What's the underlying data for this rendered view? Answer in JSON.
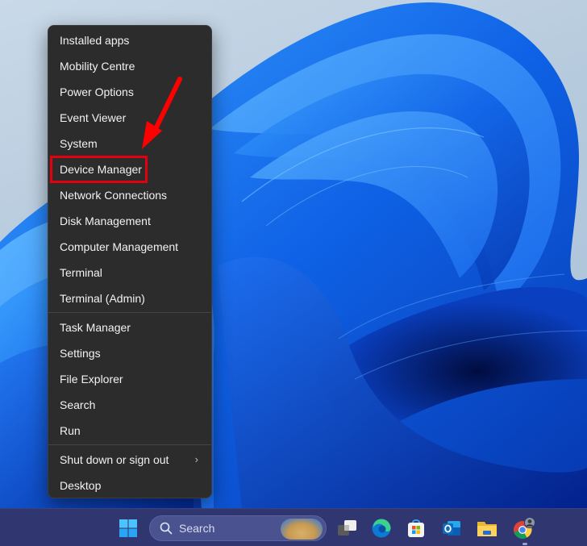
{
  "context_menu": {
    "groups": [
      [
        {
          "label": "Installed apps"
        },
        {
          "label": "Mobility Centre"
        },
        {
          "label": "Power Options"
        },
        {
          "label": "Event Viewer"
        },
        {
          "label": "System"
        },
        {
          "label": "Device Manager",
          "highlighted": true
        },
        {
          "label": "Network Connections"
        },
        {
          "label": "Disk Management"
        },
        {
          "label": "Computer Management"
        },
        {
          "label": "Terminal"
        },
        {
          "label": "Terminal (Admin)"
        }
      ],
      [
        {
          "label": "Task Manager"
        },
        {
          "label": "Settings"
        },
        {
          "label": "File Explorer"
        },
        {
          "label": "Search"
        },
        {
          "label": "Run"
        }
      ],
      [
        {
          "label": "Shut down or sign out",
          "submenu": true,
          "chevron": "›"
        },
        {
          "label": "Desktop"
        }
      ]
    ]
  },
  "annotation": {
    "highlight_target": "Device Manager",
    "highlight_color": "#e3000f",
    "arrow_color": "#ff0000"
  },
  "taskbar": {
    "search_label": "Search",
    "icons": [
      {
        "name": "start-button",
        "icon": "windows-logo-icon"
      },
      {
        "name": "task-view-button",
        "icon": "task-view-icon"
      },
      {
        "name": "edge-button",
        "icon": "edge-icon"
      },
      {
        "name": "store-button",
        "icon": "microsoft-store-icon"
      },
      {
        "name": "outlook-button",
        "icon": "outlook-icon"
      },
      {
        "name": "file-explorer-button",
        "icon": "folder-icon"
      },
      {
        "name": "chrome-button",
        "icon": "chrome-icon",
        "active": true
      }
    ]
  },
  "colors": {
    "menu_bg": "#2c2c2c",
    "menu_text": "#f2f2f2",
    "taskbar_bg": "#2f3670",
    "wallpaper_accent": "#0a5be0"
  }
}
